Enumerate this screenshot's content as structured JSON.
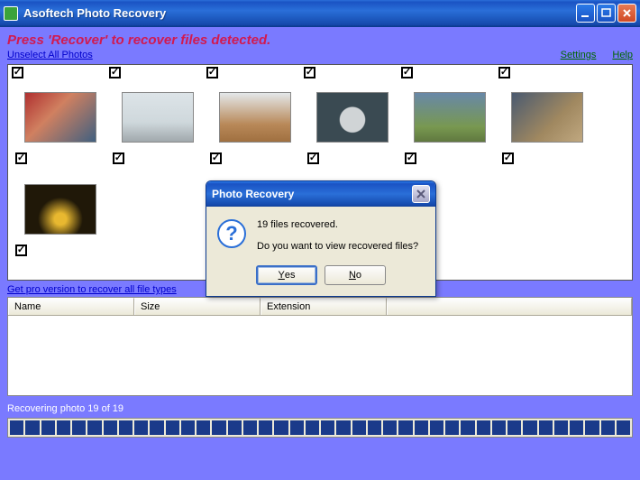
{
  "window": {
    "title": "Asoftech Photo Recovery"
  },
  "banner": {
    "headline": "Press 'Recover' to recover files detected."
  },
  "links": {
    "unselect_all": "Unselect All Photos",
    "settings": "Settings",
    "help": "Help",
    "pro_version": "Get pro version to recover all file types"
  },
  "thumbnails": [
    {
      "checked": true,
      "img": "img-marathon"
    },
    {
      "checked": true,
      "img": "img-runner"
    },
    {
      "checked": true,
      "img": "img-track"
    },
    {
      "checked": true,
      "img": "img-car"
    },
    {
      "checked": true,
      "img": "img-athlete"
    },
    {
      "checked": true,
      "img": "img-crowd"
    },
    {
      "checked": true,
      "img": "img-night"
    }
  ],
  "top_checks_count": 6,
  "table": {
    "columns": {
      "name": "Name",
      "size": "Size",
      "ext": "Extension"
    }
  },
  "status_text": "Recovering photo 19 of 19",
  "progress_segments": 40,
  "dialog": {
    "title": "Photo Recovery",
    "line1": "19 files recovered.",
    "line2": "Do you want to view recovered files?",
    "yes_pre": "",
    "yes_u": "Y",
    "yes_post": "es",
    "no_pre": "",
    "no_u": "N",
    "no_post": "o"
  },
  "checkmark_glyph": "✓"
}
